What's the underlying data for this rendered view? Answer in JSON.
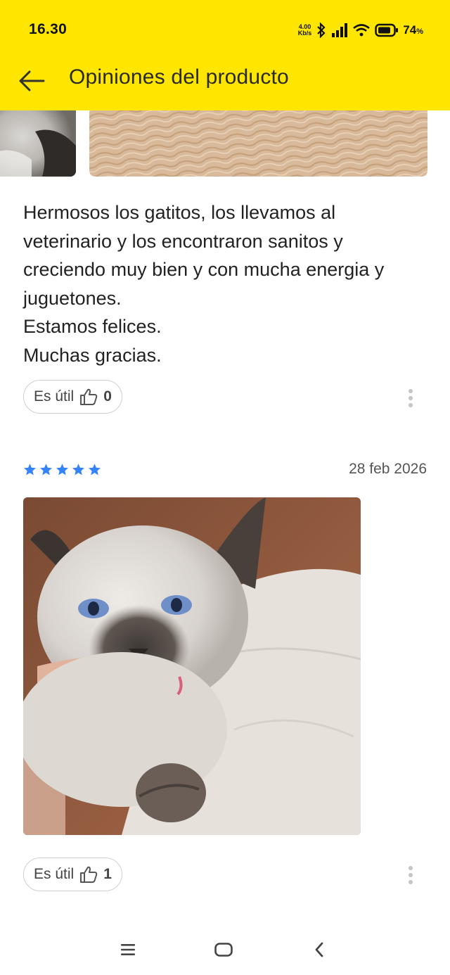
{
  "status_bar": {
    "time": "16.30",
    "net_speed_value": "4.00",
    "net_speed_unit": "Kb/s",
    "battery_value": "74",
    "battery_unit": "%"
  },
  "topbar": {
    "title": "Opiniones del producto",
    "back_icon": "arrow-left-icon"
  },
  "colors": {
    "header_bg": "#FFE600",
    "star": "#3483FA",
    "text": "#222222"
  },
  "reviews": [
    {
      "text_lines": [
        "Hermosos los gatitos, los llevamos al veterinario y los encontraron sanitos y creciendo muy bien y con mucha energia y juguetones.",
        "Estamos felices.",
        "Muchas gracias."
      ],
      "useful_label": "Es útil",
      "useful_count": "0"
    },
    {
      "rating": 5,
      "date": "28 feb 2026",
      "useful_label": "Es útil",
      "useful_count": "1"
    }
  ],
  "nav_bar": {
    "items": [
      "menu-icon",
      "home-icon",
      "back-icon"
    ]
  }
}
